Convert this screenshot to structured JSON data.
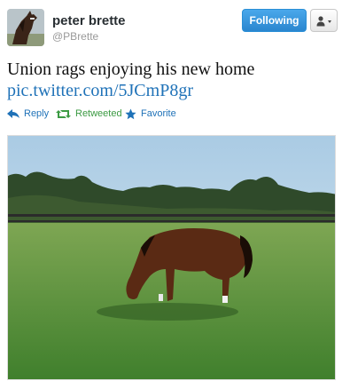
{
  "user": {
    "name": "peter brette",
    "handle": "@PBrette",
    "avatar_icon": "horse-avatar-icon"
  },
  "header": {
    "follow_label": "Following",
    "user_menu_icon": "person-icon"
  },
  "tweet": {
    "text": "Union rags enjoying his new home",
    "link": "pic.twitter.com/5JCmP8gr"
  },
  "actions": {
    "reply": "Reply",
    "retweet": "Retweeted",
    "favorite": "Favorite"
  },
  "colors": {
    "link": "#1f72b8",
    "retweeted": "#3b9a42",
    "follow_button": "#2a86cf"
  }
}
